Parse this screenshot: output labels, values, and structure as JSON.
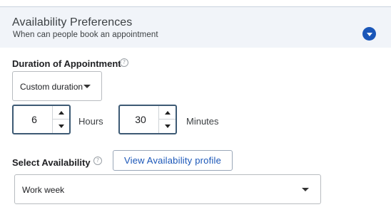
{
  "header": {
    "title": "Availability Preferences",
    "subtitle": "When can people book an appointment",
    "collapse_icon": "chevron-down-icon",
    "accent_color": "#1a56b8"
  },
  "duration": {
    "label": "Duration of Appointment",
    "help_icon": "help-circle-icon",
    "select_value": "Custom duration",
    "hours_value": "6",
    "hours_label": "Hours",
    "minutes_value": "30",
    "minutes_label": "Minutes"
  },
  "availability": {
    "label": "Select Availability",
    "help_icon": "help-circle-icon",
    "profile_button": "View Availability profile",
    "select_value": "Work week"
  }
}
